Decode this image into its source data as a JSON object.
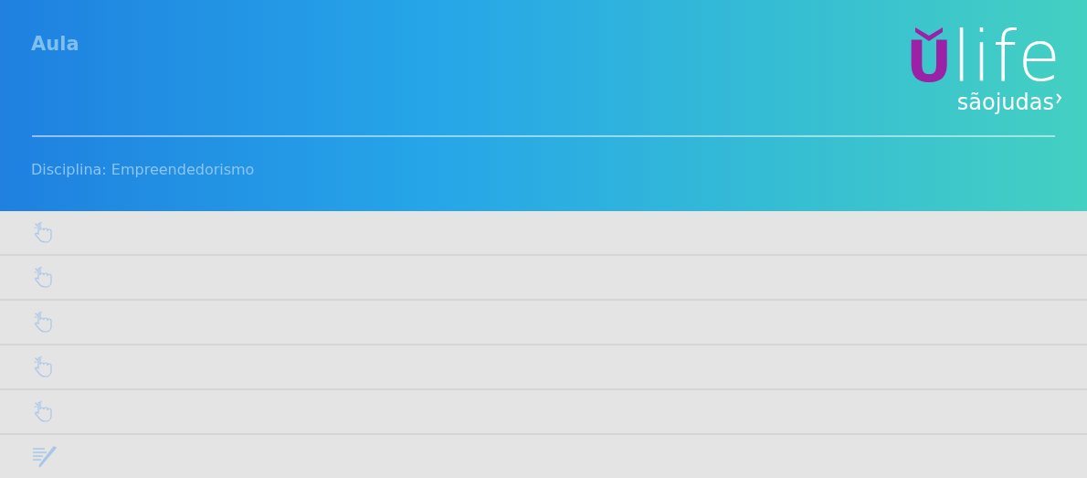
{
  "header": {
    "title": "Aula",
    "subject": "Disciplina: Empreendedorismo"
  },
  "logo": {
    "initial": "U",
    "word": "life",
    "school": "sãojudas"
  },
  "rows": [
    {
      "kind": "hand"
    },
    {
      "kind": "hand"
    },
    {
      "kind": "hand"
    },
    {
      "kind": "hand"
    },
    {
      "kind": "hand"
    },
    {
      "kind": "writing"
    }
  ]
}
